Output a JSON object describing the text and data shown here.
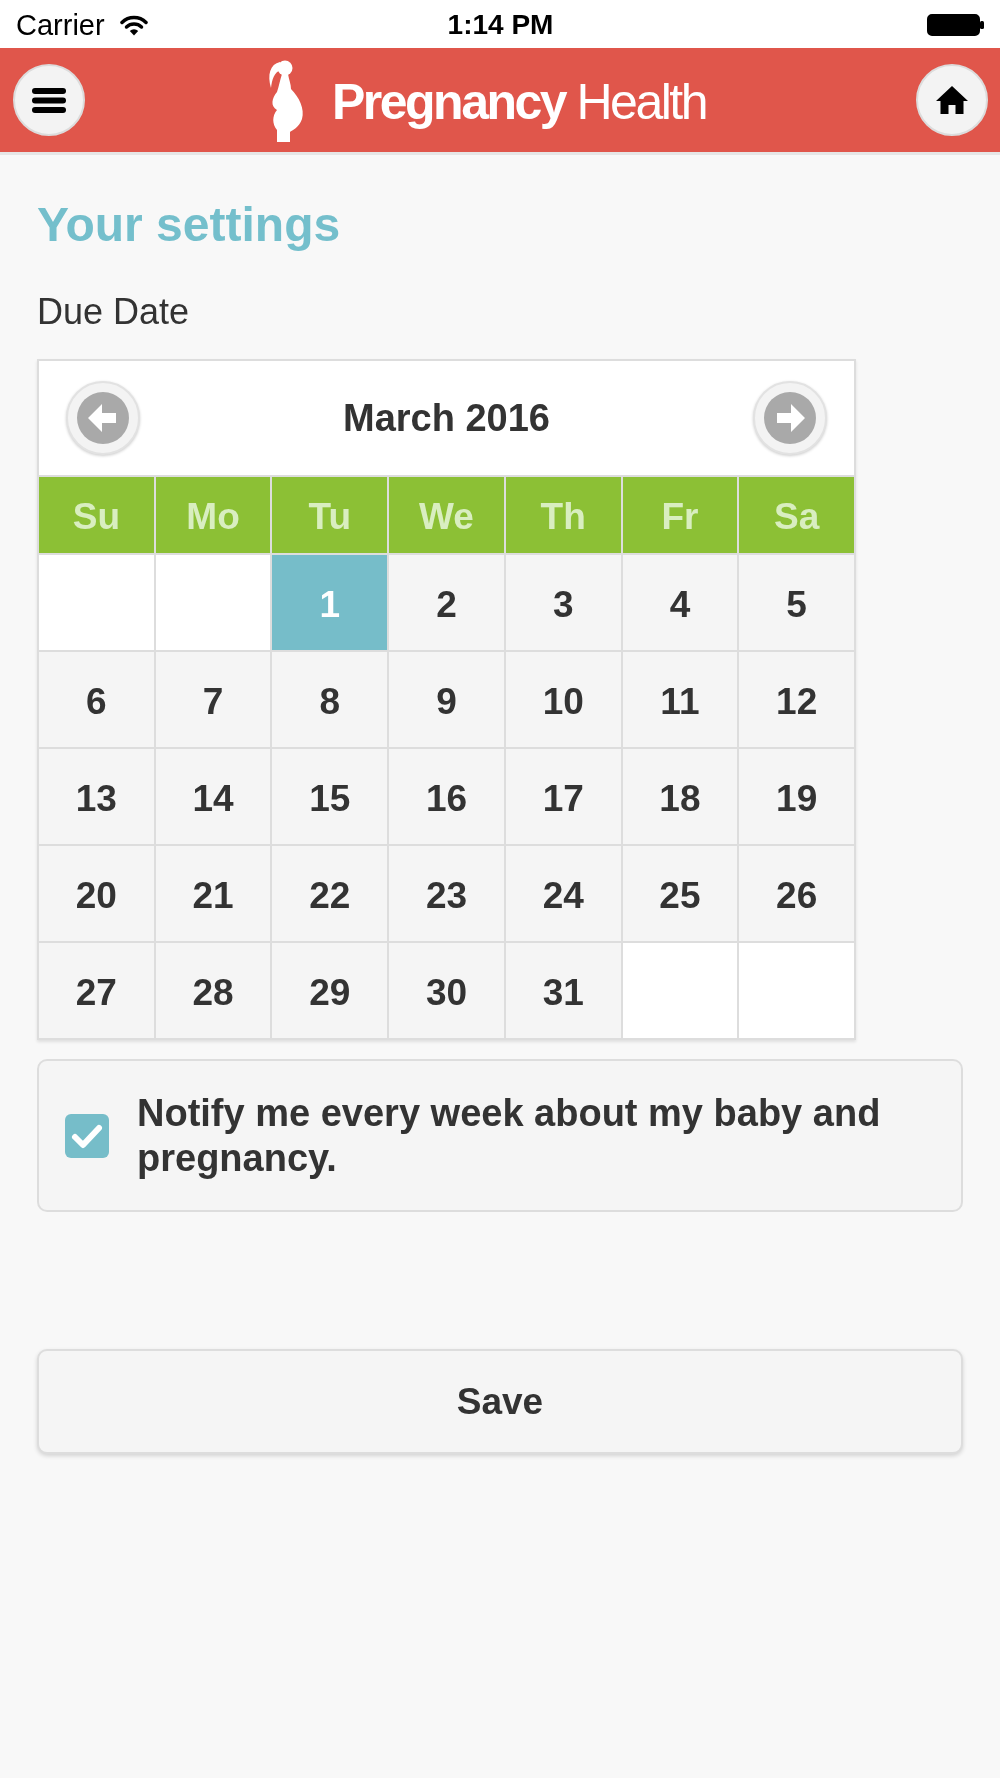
{
  "status_bar": {
    "carrier": "Carrier",
    "time": "1:14 PM"
  },
  "header": {
    "title": "**Pregnancy** Health"
  },
  "settings": {
    "title": "Your settings",
    "due_date_label": "Due Date"
  },
  "calendar": {
    "month": "March 2016",
    "weekdays": [
      "Su",
      "Mo",
      "Tu",
      "We",
      "Th",
      "Fr",
      "Sa"
    ],
    "weeks": [
      [
        {
          "kind": "blank"
        },
        {
          "kind": "blank"
        },
        {
          "kind": "day",
          "day": "1",
          "selected": true
        },
        {
          "kind": "day",
          "day": "2",
          "selected": false
        },
        {
          "kind": "day",
          "day": "3",
          "selected": false
        },
        {
          "kind": "day",
          "day": "4",
          "selected": false
        },
        {
          "kind": "day",
          "day": "5",
          "selected": false
        }
      ],
      [
        {
          "kind": "day",
          "day": "6",
          "selected": false
        },
        {
          "kind": "day",
          "day": "7",
          "selected": false
        },
        {
          "kind": "day",
          "day": "8",
          "selected": false
        },
        {
          "kind": "day",
          "day": "9",
          "selected": false
        },
        {
          "kind": "day",
          "day": "10",
          "selected": false
        },
        {
          "kind": "day",
          "day": "11",
          "selected": false
        },
        {
          "kind": "day",
          "day": "12",
          "selected": false
        }
      ],
      [
        {
          "kind": "day",
          "day": "13",
          "selected": false
        },
        {
          "kind": "day",
          "day": "14",
          "selected": false
        },
        {
          "kind": "day",
          "day": "15",
          "selected": false
        },
        {
          "kind": "day",
          "day": "16",
          "selected": false
        },
        {
          "kind": "day",
          "day": "17",
          "selected": false
        },
        {
          "kind": "day",
          "day": "18",
          "selected": false
        },
        {
          "kind": "day",
          "day": "19",
          "selected": false
        }
      ],
      [
        {
          "kind": "day",
          "day": "20",
          "selected": false
        },
        {
          "kind": "day",
          "day": "21",
          "selected": false
        },
        {
          "kind": "day",
          "day": "22",
          "selected": false
        },
        {
          "kind": "day",
          "day": "23",
          "selected": false
        },
        {
          "kind": "day",
          "day": "24",
          "selected": false
        },
        {
          "kind": "day",
          "day": "25",
          "selected": false
        },
        {
          "kind": "day",
          "day": "26",
          "selected": false
        }
      ],
      [
        {
          "kind": "day",
          "day": "27",
          "selected": false
        },
        {
          "kind": "day",
          "day": "28",
          "selected": false
        },
        {
          "kind": "day",
          "day": "29",
          "selected": false
        },
        {
          "kind": "day",
          "day": "30",
          "selected": false
        },
        {
          "kind": "day",
          "day": "31",
          "selected": false
        },
        {
          "kind": "blank"
        },
        {
          "kind": "blank"
        }
      ]
    ]
  },
  "notify": {
    "label": "Notify me every week about my baby and pregnancy.",
    "checked": true
  },
  "save_button": {
    "label": "Save"
  }
}
